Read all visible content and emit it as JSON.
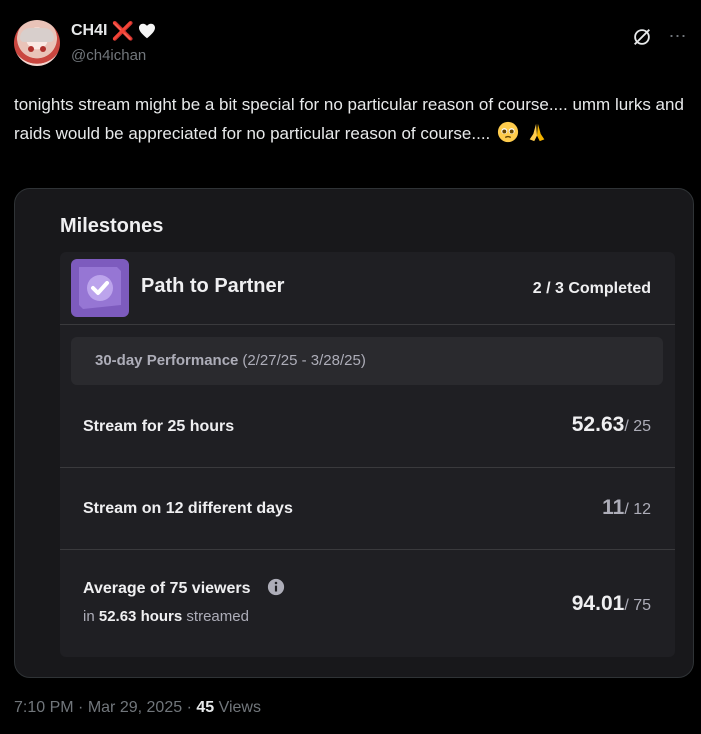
{
  "author": {
    "display_name": "CH4I",
    "name_emoji_1": "❌",
    "handle": "@ch4ichan"
  },
  "icons": {
    "avatar": "avatar",
    "heart": "white-heart-icon",
    "grok": "grok-icon",
    "more": "more-icon",
    "badge": "partner-check-icon",
    "info": "info-icon",
    "pleading": "pleading-face-emoji",
    "praying": "folded-hands-emoji"
  },
  "tweet": {
    "text": "tonights stream might be a bit special for no particular reason of course.... umm lurks and raids would be appreciated for no particular reason of course...."
  },
  "media": {
    "milestones_title": "Milestones",
    "path_title": "Path to Partner",
    "completed": "2 / 3 Completed",
    "performance_label": "30-day Performance",
    "performance_range": "(2/27/25 - 3/28/25)",
    "rows": [
      {
        "label": "Stream for 25 hours",
        "value": "52.63",
        "target": "/ 25"
      },
      {
        "label": "Stream on 12 different days",
        "value": "11",
        "target": "/ 12"
      },
      {
        "label": "Average of 75 viewers",
        "value": "94.01",
        "target": "/ 75",
        "sub_prefix": "in",
        "sub_hours": "52.63 hours",
        "sub_suffix": "streamed"
      }
    ]
  },
  "footer": {
    "time": "7:10 PM",
    "separator": "·",
    "date": "Mar 29, 2025",
    "views_count": "45",
    "views_label": "Views"
  },
  "colors": {
    "background": "#000000",
    "card": "#1f1f23",
    "twitch_purple": "#7d5bbe",
    "muted": "#71767b"
  }
}
